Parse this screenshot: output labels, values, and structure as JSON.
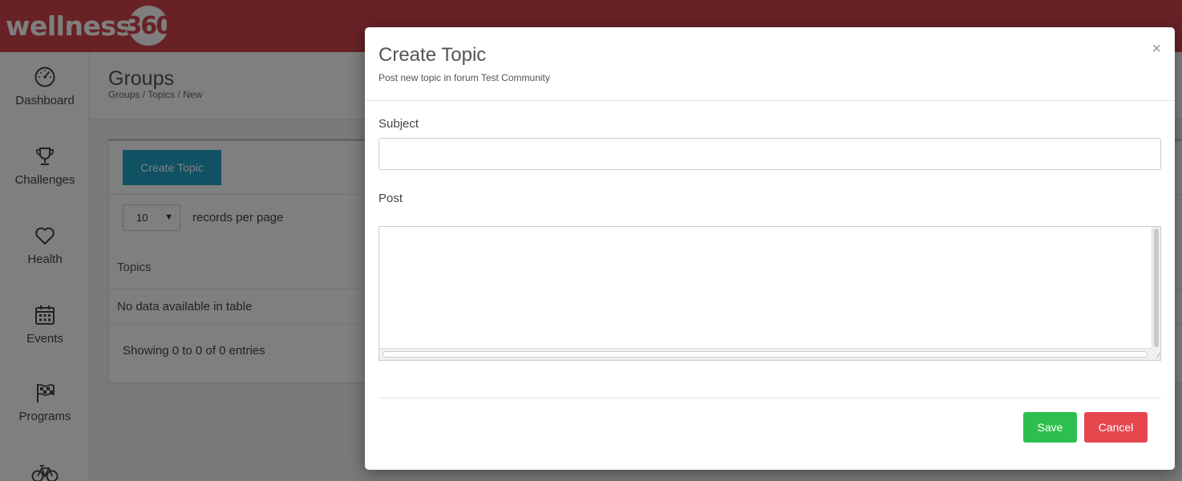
{
  "brand": {
    "name": "wellness",
    "number": "360"
  },
  "sidebar": {
    "items": [
      {
        "label": "Dashboard",
        "icon": "speedometer-icon"
      },
      {
        "label": "Challenges",
        "icon": "trophy-icon"
      },
      {
        "label": "Health",
        "icon": "heart-icon"
      },
      {
        "label": "Events",
        "icon": "calendar-icon"
      },
      {
        "label": "Programs",
        "icon": "flag-icon"
      },
      {
        "label": "",
        "icon": "bicycle-icon"
      }
    ]
  },
  "page": {
    "title": "Groups",
    "breadcrumb": "Groups / Topics / New"
  },
  "card": {
    "create_button": "Create Topic",
    "per_page_value": "10",
    "per_page_label": "records per page",
    "column_header": "Topics",
    "empty_message": "No data available in table",
    "showing": "Showing 0 to 0 of 0 entries"
  },
  "modal": {
    "title": "Create Topic",
    "subtitle": "Post new topic in forum Test Community",
    "close": "×",
    "subject_label": "Subject",
    "subject_value": "",
    "post_label": "Post",
    "post_value": "",
    "save_label": "Save",
    "cancel_label": "Cancel"
  },
  "colors": {
    "brand_red": "#d0454c",
    "create_blue": "#23a3c9",
    "save_green": "#2cbf4d",
    "cancel_red": "#e5474f"
  }
}
